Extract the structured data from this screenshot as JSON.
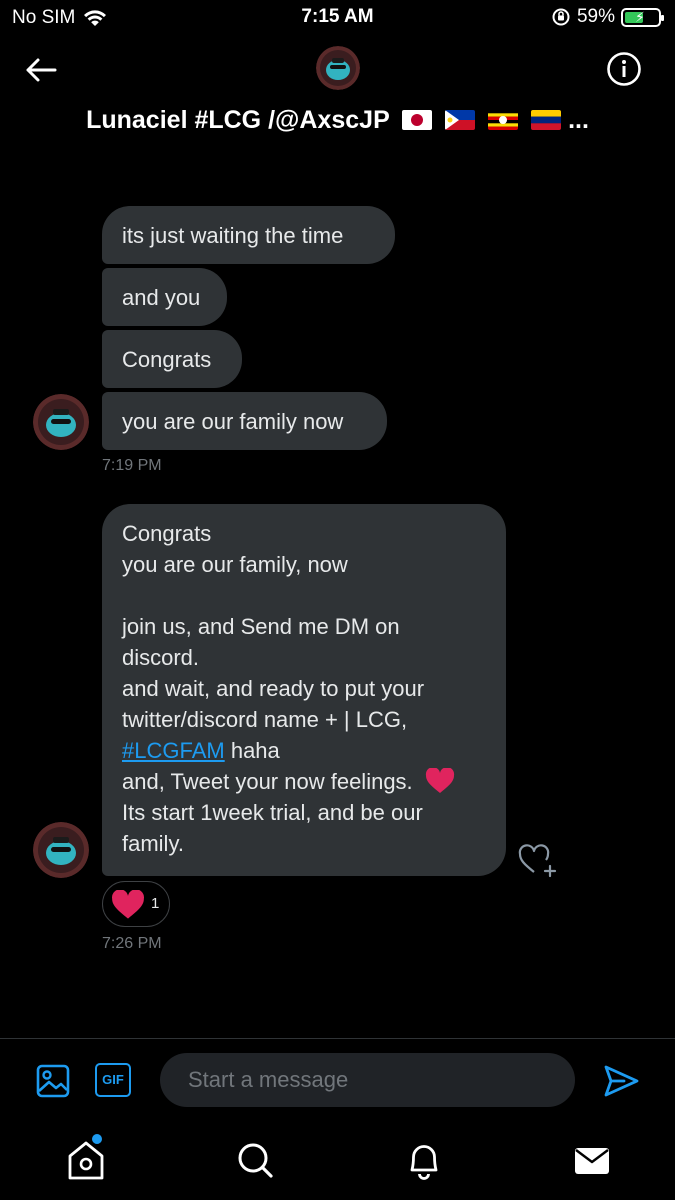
{
  "status_bar": {
    "carrier": "No SIM",
    "time": "7:15 AM",
    "battery": "59%",
    "battery_level": 0.59,
    "icons": [
      "wifi-icon",
      "orientation-lock-icon",
      "battery-charging-icon"
    ]
  },
  "header": {
    "title": "Lunaciel #LCG /@AxscJP",
    "flags": [
      "japan",
      "philippines",
      "uganda",
      "venezuela"
    ],
    "ellipsis": "...",
    "icons": [
      "back-arrow-icon",
      "info-icon"
    ]
  },
  "messages": [
    {
      "text": "its just waiting the time"
    },
    {
      "text": "and you"
    },
    {
      "text": "Congrats"
    },
    {
      "text": "you are our family now"
    }
  ],
  "timestamp_1": "7:19 PM",
  "long_message": {
    "lines": [
      "Congrats",
      "you are our family, now",
      "",
      "join us, and Send me DM on",
      "discord.",
      "and wait, and ready to put your",
      "twitter/discord name + |  LCG,",
      "haha",
      "and, Tweet your now feelings.",
      "Its start 1week trial, and be our",
      "family."
    ],
    "hashtag": "#LCGFAM",
    "emoji": "red-heart"
  },
  "reaction": {
    "emoji": "red-heart",
    "count": "1"
  },
  "timestamp_2": "7:26 PM",
  "composer": {
    "placeholder": "Start a message",
    "gif_label": "GIF",
    "icons": [
      "image-icon",
      "gif-icon",
      "send-icon"
    ]
  },
  "tab_bar": {
    "icons": [
      "home-icon",
      "search-icon",
      "notifications-bell-icon",
      "messages-envelope-icon"
    ],
    "home_has_notification_dot": true
  },
  "colors": {
    "background": "#000000",
    "bubble": "#2f3336",
    "accent": "#1d9bf0",
    "muted": "#71767b",
    "heart": "#e0245e"
  }
}
